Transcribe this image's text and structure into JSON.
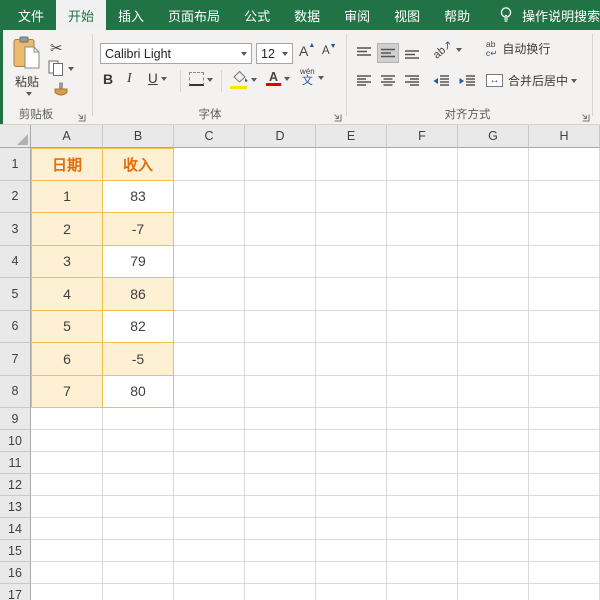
{
  "colors": {
    "green": "#217346",
    "orange": "#E46C0A",
    "cream": "#FDF0D3",
    "gold": "#F0C051",
    "blue": "#2B579A",
    "swatch_yellow": "#FFE100",
    "swatch_red": "#E40000"
  },
  "tabs": [
    {
      "id": "file",
      "label": "文件",
      "active": false
    },
    {
      "id": "home",
      "label": "开始",
      "active": true
    },
    {
      "id": "insert",
      "label": "插入",
      "active": false
    },
    {
      "id": "page-layout",
      "label": "页面布局",
      "active": false
    },
    {
      "id": "formulas",
      "label": "公式",
      "active": false
    },
    {
      "id": "data",
      "label": "数据",
      "active": false
    },
    {
      "id": "review",
      "label": "审阅",
      "active": false
    },
    {
      "id": "view",
      "label": "视图",
      "active": false
    },
    {
      "id": "help",
      "label": "帮助",
      "active": false
    }
  ],
  "tellme": {
    "label": "操作说明搜索"
  },
  "ribbon": {
    "clipboard": {
      "paste_label": "粘贴",
      "group_label": "剪贴板"
    },
    "font": {
      "font_name": "Calibri Light",
      "font_size": "12",
      "bold_label": "B",
      "italic_label": "I",
      "underline_label": "U",
      "grow_font_label": "A",
      "shrink_font_label": "A",
      "phonetic_top": "wén",
      "phonetic_bottom": "文",
      "font_color_label": "A",
      "group_label": "字体"
    },
    "alignment": {
      "orientation_icon_text": "ab",
      "wrap_icon_line1": "ab",
      "wrap_icon_line2": "c",
      "wrap_label": "自动换行",
      "merge_label": "合并后居中",
      "group_label": "对齐方式"
    }
  },
  "sheet": {
    "columns": [
      "A",
      "B",
      "C",
      "D",
      "E",
      "F",
      "G",
      "H"
    ],
    "row_count": 17,
    "table": {
      "range": "A1:B8",
      "rows": [
        {
          "n": 1,
          "a": "日期",
          "b": "收入",
          "header": true
        },
        {
          "n": 2,
          "a": "1",
          "b": "83",
          "b_white": true
        },
        {
          "n": 3,
          "a": "2",
          "b": "-7"
        },
        {
          "n": 4,
          "a": "3",
          "b": "79",
          "b_white": true
        },
        {
          "n": 5,
          "a": "4",
          "b": "86"
        },
        {
          "n": 6,
          "a": "5",
          "b": "82",
          "b_white": true
        },
        {
          "n": 7,
          "a": "6",
          "b": "-5"
        },
        {
          "n": 8,
          "a": "7",
          "b": "80",
          "b_white": true
        }
      ]
    }
  }
}
